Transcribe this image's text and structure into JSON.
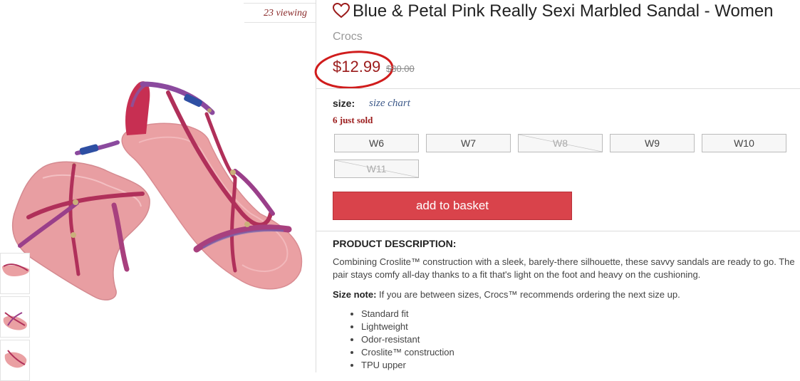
{
  "product": {
    "title": "Blue & Petal Pink Really Sexi Marbled Sandal - Women",
    "brand": "Crocs",
    "price": "$12.99",
    "old_price": "$30.00",
    "viewing": "23 viewing"
  },
  "sizes": {
    "label": "size:",
    "chart_link": "size chart",
    "sold_note": "6 just sold",
    "options": [
      {
        "label": "W6",
        "available": true
      },
      {
        "label": "W7",
        "available": true
      },
      {
        "label": "W8",
        "available": false
      },
      {
        "label": "W9",
        "available": true
      },
      {
        "label": "W10",
        "available": true
      },
      {
        "label": "W11",
        "available": false
      }
    ]
  },
  "actions": {
    "add_to_basket": "add to basket"
  },
  "description": {
    "heading": "PRODUCT DESCRIPTION:",
    "body": "Combining Croslite™ construction with a sleek, barely-there silhouette, these savvy sandals are ready to go. The pair stays comfy all-day thanks to a fit that's light on the foot and heavy on the cushioning.",
    "size_note_label": "Size note:",
    "size_note": " If you are between sizes, Crocs™ recommends ordering the next size up.",
    "features": [
      "Standard fit",
      "Lightweight",
      "Odor-resistant",
      "Croslite™ construction",
      "TPU upper"
    ]
  },
  "colors": {
    "accent_red": "#d9434b",
    "price_red": "#9b1b1b",
    "annotation_circle": "#d01c1c",
    "sandal_sole": "#eaa0a3",
    "sandal_strap": "#b0305a",
    "strap_marble_blue": "#5a5aa8"
  }
}
